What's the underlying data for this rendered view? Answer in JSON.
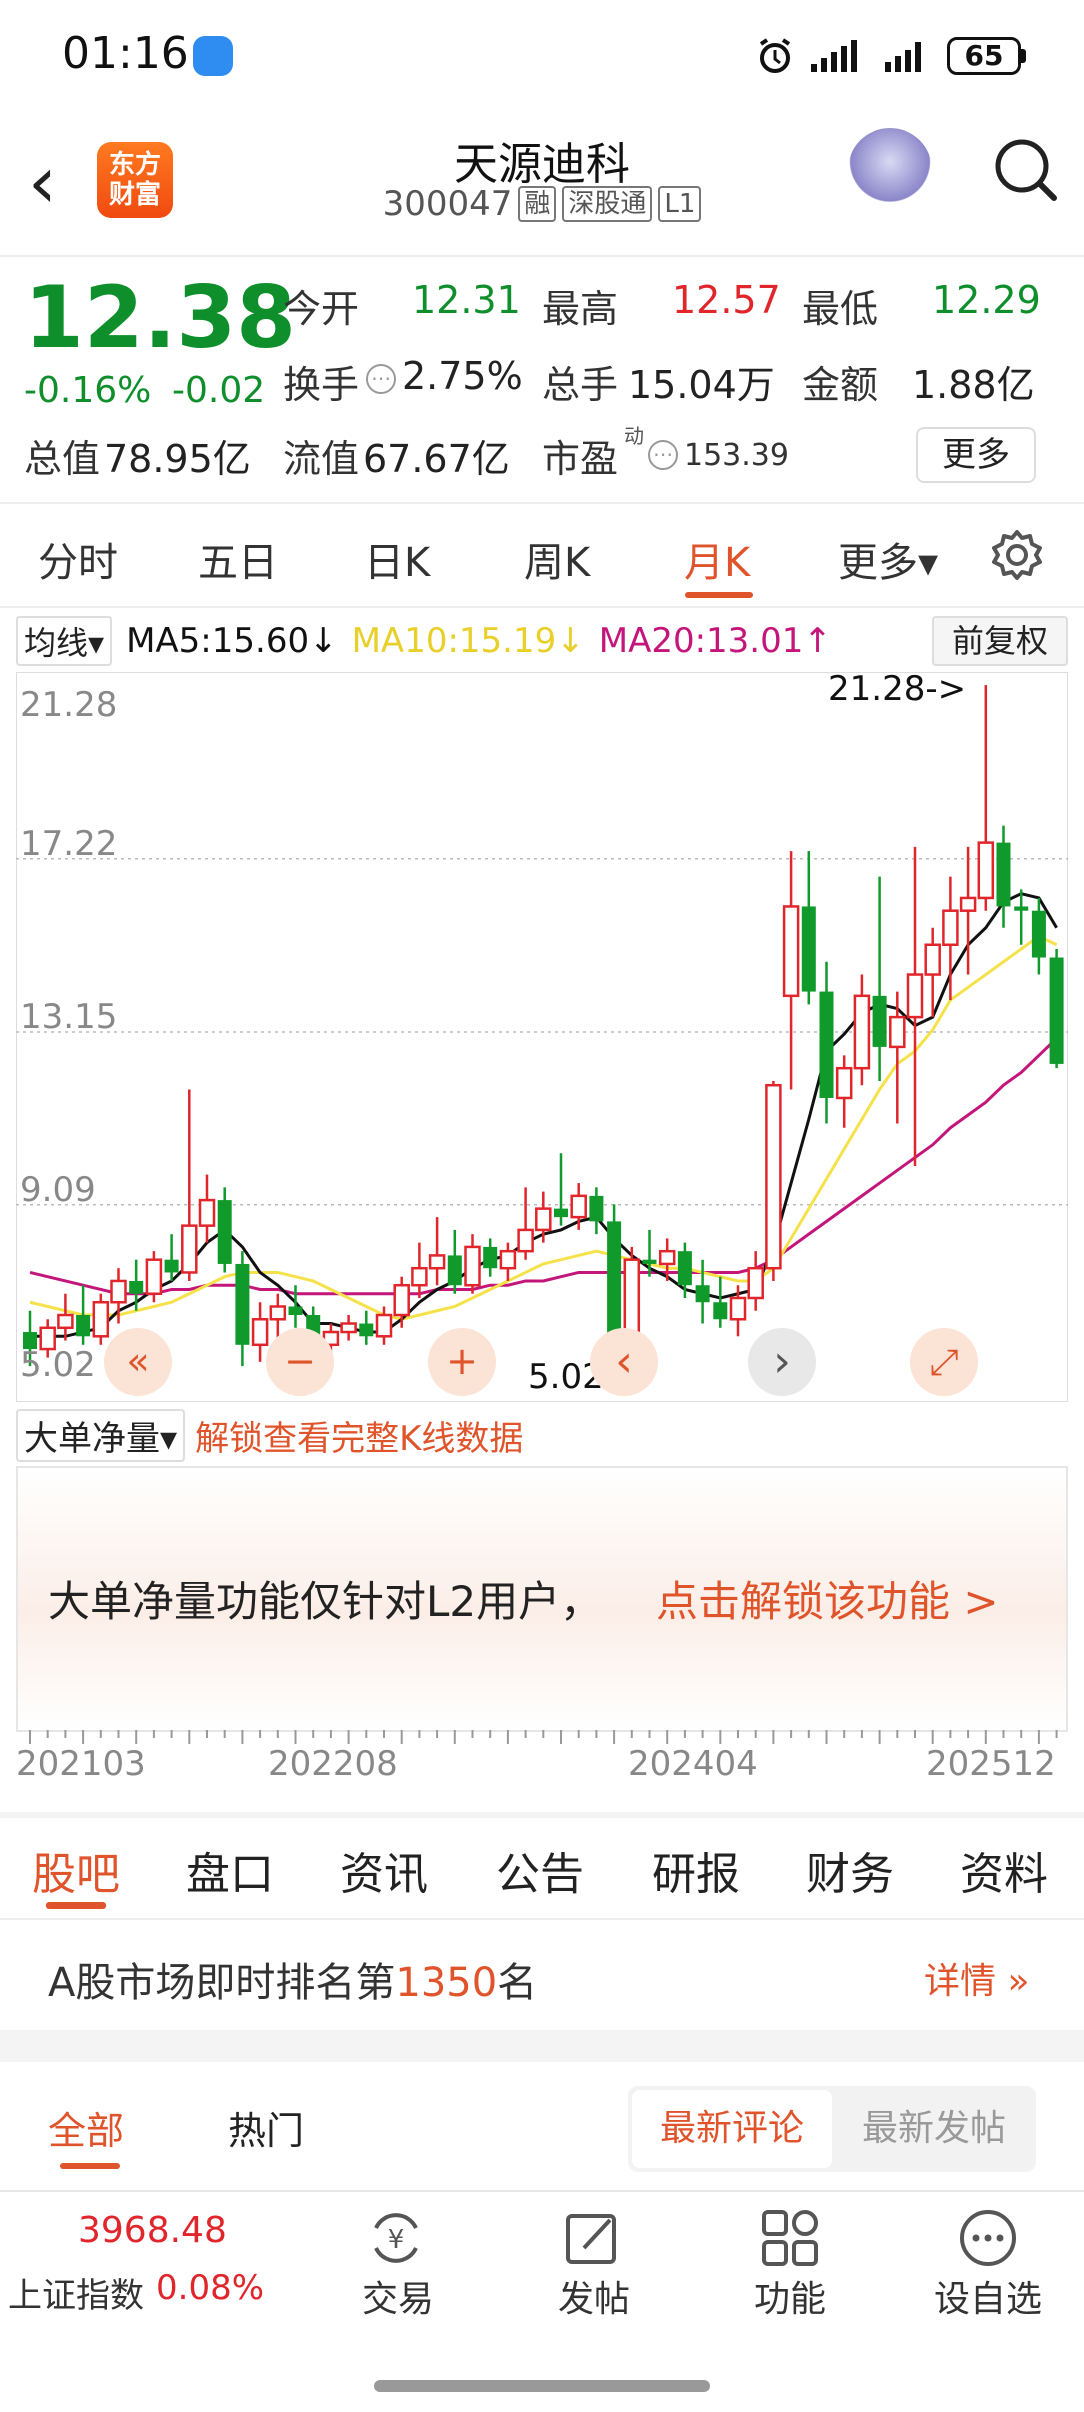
{
  "status": {
    "time": "01:16",
    "battery": "65"
  },
  "header": {
    "logo_line1": "东方",
    "logo_line2": "财富",
    "stock_name": "天源迪科",
    "stock_code": "300047",
    "tags": [
      "融",
      "深股通",
      "L1"
    ]
  },
  "quote": {
    "price": "12.38",
    "change_pct": "-0.16%",
    "change_abs": "-0.02",
    "open_label": "今开",
    "open": "12.31",
    "high_label": "最高",
    "high": "12.57",
    "low_label": "最低",
    "low": "12.29",
    "turnover_label": "换手",
    "turnover": "2.75%",
    "volume_label": "总手",
    "volume": "15.04万",
    "amount_label": "金额",
    "amount": "1.88亿",
    "mktcap_label": "总值",
    "mktcap": "78.95亿",
    "float_label": "流值",
    "float": "67.67亿",
    "pe_label": "市盈",
    "pe_sup": "动",
    "pe": "153.39",
    "more": "更多"
  },
  "period_tabs": [
    "分时",
    "五日",
    "日K",
    "周K",
    "月K",
    "更多▾"
  ],
  "period_active": "月K",
  "ma": {
    "select": "均线",
    "ma5": "MA5:15.60↓",
    "ma10": "MA10:15.19↓",
    "ma20": "MA20:13.01↑",
    "ma5_color": "#111111",
    "ma10_color": "#f5e24a",
    "ma20_color": "#c4157a",
    "fuquan": "前复权"
  },
  "chart_data": {
    "type": "candlestick",
    "period": "月K",
    "y_ticks": [
      "21.28",
      "17.22",
      "13.15",
      "9.09",
      "5.02"
    ],
    "ylim": [
      5.02,
      21.28
    ],
    "max_marker": "21.28->",
    "min_marker": "5.02->",
    "x_ticks": [
      "202103",
      "202208",
      "202404",
      "202512"
    ],
    "up_color": "#e0252b",
    "down_color": "#0f9a2b",
    "candles": [
      {
        "o": 6.1,
        "h": 6.6,
        "l": 5.3,
        "c": 5.7
      },
      {
        "o": 5.7,
        "h": 6.4,
        "l": 5.5,
        "c": 6.2
      },
      {
        "o": 6.2,
        "h": 7.0,
        "l": 5.9,
        "c": 6.5
      },
      {
        "o": 6.5,
        "h": 7.2,
        "l": 5.8,
        "c": 6.0
      },
      {
        "o": 6.0,
        "h": 7.0,
        "l": 5.8,
        "c": 6.8
      },
      {
        "o": 6.8,
        "h": 7.6,
        "l": 6.3,
        "c": 7.3
      },
      {
        "o": 7.3,
        "h": 7.8,
        "l": 6.6,
        "c": 7.0
      },
      {
        "o": 7.0,
        "h": 8.0,
        "l": 6.8,
        "c": 7.8
      },
      {
        "o": 7.8,
        "h": 8.4,
        "l": 7.3,
        "c": 7.5
      },
      {
        "o": 7.5,
        "h": 11.8,
        "l": 7.3,
        "c": 8.6
      },
      {
        "o": 8.6,
        "h": 9.8,
        "l": 8.2,
        "c": 9.2
      },
      {
        "o": 9.2,
        "h": 9.5,
        "l": 7.5,
        "c": 7.7
      },
      {
        "o": 7.7,
        "h": 8.0,
        "l": 5.3,
        "c": 5.8
      },
      {
        "o": 5.8,
        "h": 6.8,
        "l": 5.4,
        "c": 6.4
      },
      {
        "o": 6.4,
        "h": 7.0,
        "l": 5.9,
        "c": 6.7
      },
      {
        "o": 6.7,
        "h": 7.2,
        "l": 6.2,
        "c": 6.5
      },
      {
        "o": 6.5,
        "h": 6.7,
        "l": 5.5,
        "c": 5.8
      },
      {
        "o": 5.8,
        "h": 6.3,
        "l": 5.5,
        "c": 6.1
      },
      {
        "o": 6.1,
        "h": 6.5,
        "l": 5.9,
        "c": 6.3
      },
      {
        "o": 6.3,
        "h": 6.6,
        "l": 5.8,
        "c": 6.0
      },
      {
        "o": 6.0,
        "h": 6.7,
        "l": 5.8,
        "c": 6.5
      },
      {
        "o": 6.5,
        "h": 7.4,
        "l": 6.2,
        "c": 7.2
      },
      {
        "o": 7.2,
        "h": 8.2,
        "l": 6.9,
        "c": 7.6
      },
      {
        "o": 7.6,
        "h": 8.8,
        "l": 7.2,
        "c": 7.9
      },
      {
        "o": 7.9,
        "h": 8.5,
        "l": 7.0,
        "c": 7.2
      },
      {
        "o": 7.2,
        "h": 8.4,
        "l": 7.0,
        "c": 8.1
      },
      {
        "o": 8.1,
        "h": 8.3,
        "l": 7.4,
        "c": 7.6
      },
      {
        "o": 7.6,
        "h": 8.2,
        "l": 7.3,
        "c": 8.0
      },
      {
        "o": 8.0,
        "h": 9.5,
        "l": 7.8,
        "c": 8.5
      },
      {
        "o": 8.5,
        "h": 9.4,
        "l": 8.2,
        "c": 9.0
      },
      {
        "o": 9.0,
        "h": 10.3,
        "l": 8.6,
        "c": 8.8
      },
      {
        "o": 8.8,
        "h": 9.6,
        "l": 8.5,
        "c": 9.3
      },
      {
        "o": 9.3,
        "h": 9.5,
        "l": 8.4,
        "c": 8.7
      },
      {
        "o": 8.7,
        "h": 9.1,
        "l": 5.2,
        "c": 5.9
      },
      {
        "o": 5.9,
        "h": 8.1,
        "l": 5.1,
        "c": 7.8
      },
      {
        "o": 7.8,
        "h": 8.5,
        "l": 7.4,
        "c": 7.7
      },
      {
        "o": 7.7,
        "h": 8.3,
        "l": 7.3,
        "c": 8.0
      },
      {
        "o": 8.0,
        "h": 8.2,
        "l": 6.9,
        "c": 7.2
      },
      {
        "o": 7.2,
        "h": 7.8,
        "l": 6.3,
        "c": 6.8
      },
      {
        "o": 6.8,
        "h": 7.4,
        "l": 6.2,
        "c": 6.4
      },
      {
        "o": 6.4,
        "h": 7.2,
        "l": 6.0,
        "c": 6.9
      },
      {
        "o": 6.9,
        "h": 8.0,
        "l": 6.6,
        "c": 7.6
      },
      {
        "o": 7.6,
        "h": 12.0,
        "l": 7.3,
        "c": 11.9
      },
      {
        "o": 14.0,
        "h": 17.4,
        "l": 11.8,
        "c": 16.1
      },
      {
        "o": 16.1,
        "h": 17.4,
        "l": 13.8,
        "c": 14.1
      },
      {
        "o": 14.1,
        "h": 14.8,
        "l": 11.0,
        "c": 11.6
      },
      {
        "o": 11.6,
        "h": 12.6,
        "l": 10.9,
        "c": 12.3
      },
      {
        "o": 12.3,
        "h": 14.5,
        "l": 11.9,
        "c": 14.0
      },
      {
        "o": 14.0,
        "h": 16.8,
        "l": 12.0,
        "c": 12.8
      },
      {
        "o": 12.8,
        "h": 14.1,
        "l": 11.0,
        "c": 13.5
      },
      {
        "o": 13.5,
        "h": 17.5,
        "l": 10.0,
        "c": 14.5
      },
      {
        "o": 14.5,
        "h": 15.6,
        "l": 13.5,
        "c": 15.2
      },
      {
        "o": 15.2,
        "h": 16.8,
        "l": 13.9,
        "c": 16.0
      },
      {
        "o": 16.0,
        "h": 17.5,
        "l": 14.5,
        "c": 16.3
      },
      {
        "o": 16.3,
        "h": 21.3,
        "l": 16.0,
        "c": 17.6
      },
      {
        "o": 17.6,
        "h": 18.0,
        "l": 15.6,
        "c": 16.1
      },
      {
        "o": 16.1,
        "h": 16.5,
        "l": 15.2,
        "c": 16.0
      },
      {
        "o": 16.0,
        "h": 16.3,
        "l": 14.5,
        "c": 14.9
      },
      {
        "o": 14.9,
        "h": 15.1,
        "l": 12.3,
        "c": 12.4
      }
    ],
    "ma5": [
      6.0,
      6.0,
      6.0,
      6.1,
      6.2,
      6.6,
      6.8,
      7.1,
      7.3,
      7.7,
      8.2,
      8.5,
      8.1,
      7.5,
      7.2,
      6.8,
      6.3,
      6.3,
      6.2,
      6.1,
      6.1,
      6.4,
      6.8,
      7.1,
      7.3,
      7.6,
      7.8,
      7.9,
      8.2,
      8.4,
      8.5,
      8.7,
      8.8,
      8.3,
      7.9,
      7.6,
      7.4,
      7.1,
      7.0,
      6.9,
      7.0,
      7.1,
      8.1,
      9.6,
      11.1,
      12.7,
      13.1,
      13.6,
      13.8,
      13.7,
      13.3,
      13.5,
      14.5,
      15.2,
      15.6,
      16.2,
      16.4,
      16.3,
      15.6
    ],
    "ma10": [
      6.8,
      6.7,
      6.6,
      6.5,
      6.5,
      6.5,
      6.6,
      6.7,
      6.8,
      7.0,
      7.2,
      7.4,
      7.5,
      7.5,
      7.5,
      7.4,
      7.3,
      7.1,
      6.9,
      6.7,
      6.5,
      6.4,
      6.5,
      6.6,
      6.7,
      6.9,
      7.1,
      7.3,
      7.5,
      7.7,
      7.8,
      7.9,
      8.0,
      7.9,
      7.8,
      7.7,
      7.6,
      7.6,
      7.5,
      7.4,
      7.3,
      7.3,
      7.6,
      8.3,
      9.0,
      9.7,
      10.4,
      11.1,
      11.8,
      12.4,
      12.7,
      13.2,
      13.9,
      14.2,
      14.5,
      14.8,
      15.1,
      15.4,
      15.2
    ],
    "ma20": [
      7.5,
      7.4,
      7.3,
      7.2,
      7.1,
      7.0,
      7.0,
      7.0,
      7.1,
      7.1,
      7.2,
      7.2,
      7.2,
      7.1,
      7.1,
      7.0,
      7.0,
      7.0,
      7.0,
      7.0,
      7.0,
      7.0,
      7.0,
      7.1,
      7.1,
      7.1,
      7.2,
      7.2,
      7.3,
      7.3,
      7.4,
      7.5,
      7.5,
      7.5,
      7.5,
      7.5,
      7.5,
      7.5,
      7.5,
      7.5,
      7.5,
      7.6,
      7.8,
      8.1,
      8.4,
      8.7,
      9.0,
      9.3,
      9.6,
      9.9,
      10.2,
      10.5,
      10.9,
      11.2,
      11.5,
      11.9,
      12.2,
      12.6,
      13.0
    ]
  },
  "chart_controls": {
    "rewind": "«",
    "zoom_out": "−",
    "zoom_in": "+",
    "prev": "‹",
    "next": "›",
    "fullscreen": "⤢"
  },
  "net_volume": {
    "select": "大单净量",
    "unlock_link": "解锁查看完整K线数据",
    "notice": "大单净量功能仅针对L2用户，",
    "notice_link": "点击解锁该功能 >"
  },
  "info_tabs": [
    "股吧",
    "盘口",
    "资讯",
    "公告",
    "研报",
    "财务",
    "资料"
  ],
  "info_active": "股吧",
  "rank": {
    "prefix": "A股市场即时排名第",
    "number": "1350",
    "suffix": "名",
    "detail": "详情 »"
  },
  "filter": {
    "tabs": [
      "全部",
      "热门"
    ],
    "sort_active": "最新评论",
    "sort_other": "最新发帖"
  },
  "bottom": {
    "index_value": "3968.48",
    "index_name": "上证指数",
    "index_chg": "0.08%",
    "items": [
      "交易",
      "发帖",
      "功能",
      "设自选"
    ]
  }
}
